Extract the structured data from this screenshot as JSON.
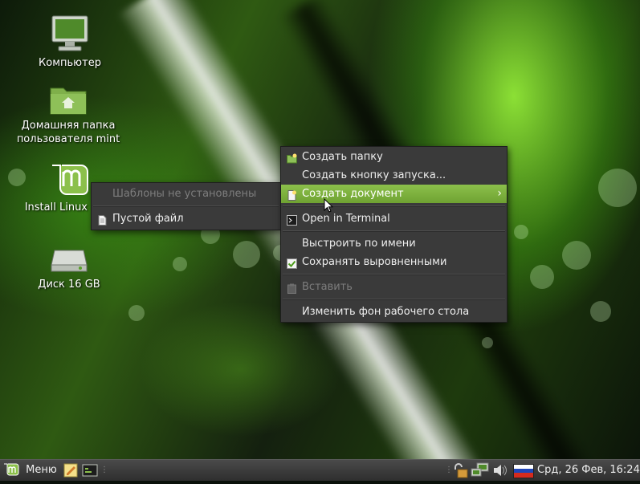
{
  "desktop": {
    "icons": [
      {
        "label": "Компьютер"
      },
      {
        "label": "Домашняя папка пользователя mint"
      },
      {
        "label": "Install Linux Mint"
      },
      {
        "label": "Диск 16 GB"
      }
    ]
  },
  "context_menu": {
    "items": [
      {
        "label": "Создать папку",
        "icon": "folder-new-icon"
      },
      {
        "label": "Создать кнопку запуска...",
        "icon": ""
      },
      {
        "label": "Создать документ",
        "icon": "document-new-icon",
        "submenu": true
      },
      {
        "label": "Open in Terminal",
        "icon": "terminal-icon"
      },
      {
        "label": "Выстроить по имени",
        "icon": ""
      },
      {
        "label": "Сохранять выровненными",
        "icon": "checkbox-checked-icon",
        "checked": true
      },
      {
        "label": "Вставить",
        "icon": "paste-icon",
        "disabled": true
      },
      {
        "label": "Изменить фон рабочего стола",
        "icon": ""
      }
    ]
  },
  "submenu": {
    "items": [
      {
        "label": "Шаблоны не установлены",
        "disabled": true
      },
      {
        "label": "Пустой файл",
        "icon": "file-icon"
      }
    ]
  },
  "taskbar": {
    "menu_label": "Меню",
    "clock": "Срд, 26 Фев, 16:24"
  },
  "colors": {
    "highlight": "#8cc04b",
    "menu_bg": "#3a3a3a",
    "panel_bg": "#3a3a3a"
  }
}
